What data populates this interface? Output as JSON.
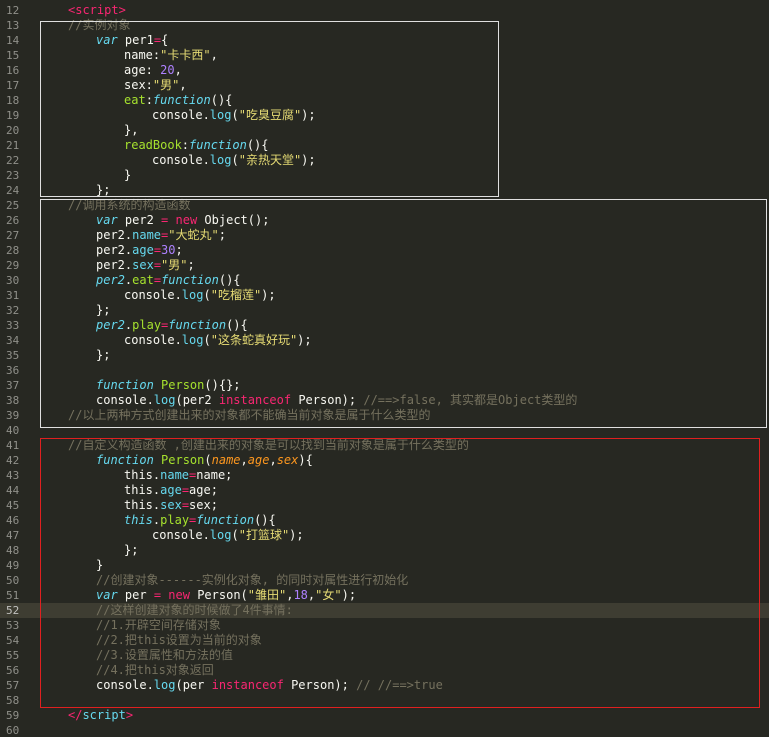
{
  "editor": {
    "theme": "monokai",
    "colors": {
      "background": "#272822",
      "highlight_box_white": "#e0e0e0",
      "highlight_box_red": "#e02020"
    },
    "current_line": 52,
    "lines": [
      {
        "n": "12",
        "indent": 4,
        "tokens": [
          [
            "tag",
            "<script>"
          ]
        ]
      },
      {
        "n": "13",
        "indent": 4,
        "tokens": [
          [
            "comment",
            "//实例对象"
          ]
        ]
      },
      {
        "n": "14",
        "indent": 8,
        "tokens": [
          [
            "kw",
            "var"
          ],
          [
            "punct",
            " per1"
          ],
          [
            "op",
            "="
          ],
          [
            "punct",
            "{"
          ]
        ]
      },
      {
        "n": "15",
        "indent": 12,
        "tokens": [
          [
            "punct",
            "name:"
          ],
          [
            "str",
            "\"卡卡西\""
          ],
          [
            "punct",
            ","
          ]
        ]
      },
      {
        "n": "16",
        "indent": 12,
        "tokens": [
          [
            "punct",
            "age: "
          ],
          [
            "num",
            "20"
          ],
          [
            "punct",
            ","
          ]
        ]
      },
      {
        "n": "17",
        "indent": 12,
        "tokens": [
          [
            "punct",
            "sex:"
          ],
          [
            "str",
            "\"男\""
          ],
          [
            "punct",
            ","
          ]
        ]
      },
      {
        "n": "18",
        "indent": 12,
        "tokens": [
          [
            "prop",
            "eat"
          ],
          [
            "punct",
            ":"
          ],
          [
            "kw",
            "function"
          ],
          [
            "punct",
            "(){"
          ]
        ]
      },
      {
        "n": "19",
        "indent": 16,
        "tokens": [
          [
            "punct",
            "console."
          ],
          [
            "sup",
            "log"
          ],
          [
            "punct",
            "("
          ],
          [
            "str",
            "\"吃臭豆腐\""
          ],
          [
            "punct",
            ");"
          ]
        ]
      },
      {
        "n": "20",
        "indent": 12,
        "tokens": [
          [
            "punct",
            "},"
          ]
        ]
      },
      {
        "n": "21",
        "indent": 12,
        "tokens": [
          [
            "prop",
            "readBook"
          ],
          [
            "punct",
            ":"
          ],
          [
            "kw",
            "function"
          ],
          [
            "punct",
            "(){"
          ]
        ]
      },
      {
        "n": "22",
        "indent": 16,
        "tokens": [
          [
            "punct",
            "console."
          ],
          [
            "sup",
            "log"
          ],
          [
            "punct",
            "("
          ],
          [
            "str",
            "\"亲热天堂\""
          ],
          [
            "punct",
            ");"
          ]
        ]
      },
      {
        "n": "23",
        "indent": 12,
        "tokens": [
          [
            "punct",
            "}"
          ]
        ]
      },
      {
        "n": "24",
        "indent": 8,
        "tokens": [
          [
            "punct",
            "};"
          ]
        ]
      },
      {
        "n": "25",
        "indent": 4,
        "tokens": [
          [
            "comment",
            "//调用系统的构造函数"
          ]
        ]
      },
      {
        "n": "26",
        "indent": 8,
        "tokens": [
          [
            "kw",
            "var"
          ],
          [
            "punct",
            " per2 "
          ],
          [
            "op",
            "="
          ],
          [
            "punct",
            " "
          ],
          [
            "op",
            "new"
          ],
          [
            "punct",
            " Object();"
          ]
        ]
      },
      {
        "n": "27",
        "indent": 8,
        "tokens": [
          [
            "punct",
            "per2."
          ],
          [
            "sup",
            "name"
          ],
          [
            "op",
            "="
          ],
          [
            "str",
            "\"大蛇丸\""
          ],
          [
            "punct",
            ";"
          ]
        ]
      },
      {
        "n": "28",
        "indent": 8,
        "tokens": [
          [
            "punct",
            "per2."
          ],
          [
            "sup",
            "age"
          ],
          [
            "op",
            "="
          ],
          [
            "num",
            "30"
          ],
          [
            "punct",
            ";"
          ]
        ]
      },
      {
        "n": "29",
        "indent": 8,
        "tokens": [
          [
            "punct",
            "per2."
          ],
          [
            "sup",
            "sex"
          ],
          [
            "op",
            "="
          ],
          [
            "str",
            "\"男\""
          ],
          [
            "punct",
            ";"
          ]
        ]
      },
      {
        "n": "30",
        "indent": 8,
        "tokens": [
          [
            "kw",
            "per2"
          ],
          [
            "punct",
            "."
          ],
          [
            "prop",
            "eat"
          ],
          [
            "op",
            "="
          ],
          [
            "kw",
            "function"
          ],
          [
            "punct",
            "(){"
          ]
        ]
      },
      {
        "n": "31",
        "indent": 12,
        "tokens": [
          [
            "punct",
            "console."
          ],
          [
            "sup",
            "log"
          ],
          [
            "punct",
            "("
          ],
          [
            "str",
            "\"吃榴莲\""
          ],
          [
            "punct",
            ");"
          ]
        ]
      },
      {
        "n": "32",
        "indent": 8,
        "tokens": [
          [
            "punct",
            "};"
          ]
        ]
      },
      {
        "n": "33",
        "indent": 8,
        "tokens": [
          [
            "kw",
            "per2"
          ],
          [
            "punct",
            "."
          ],
          [
            "prop",
            "play"
          ],
          [
            "op",
            "="
          ],
          [
            "kw",
            "function"
          ],
          [
            "punct",
            "(){"
          ]
        ]
      },
      {
        "n": "34",
        "indent": 12,
        "tokens": [
          [
            "punct",
            "console."
          ],
          [
            "sup",
            "log"
          ],
          [
            "punct",
            "("
          ],
          [
            "str",
            "\"这条蛇真好玩\""
          ],
          [
            "punct",
            ");"
          ]
        ]
      },
      {
        "n": "35",
        "indent": 8,
        "tokens": [
          [
            "punct",
            "};"
          ]
        ]
      },
      {
        "n": "36",
        "indent": 0,
        "tokens": []
      },
      {
        "n": "37",
        "indent": 8,
        "tokens": [
          [
            "kw",
            "function"
          ],
          [
            "punct",
            " "
          ],
          [
            "fn",
            "Person"
          ],
          [
            "punct",
            "(){};"
          ]
        ]
      },
      {
        "n": "38",
        "indent": 8,
        "tokens": [
          [
            "punct",
            "console."
          ],
          [
            "sup",
            "log"
          ],
          [
            "punct",
            "(per2 "
          ],
          [
            "op",
            "instanceof"
          ],
          [
            "punct",
            " Person); "
          ],
          [
            "comment",
            "//==>false, 其实都是Object类型的"
          ]
        ]
      },
      {
        "n": "39",
        "indent": 4,
        "tokens": [
          [
            "comment",
            "//以上两种方式创建出来的对象都不能确当前对象是属于什么类型的"
          ]
        ]
      },
      {
        "n": "40",
        "indent": 0,
        "tokens": []
      },
      {
        "n": "41",
        "indent": 4,
        "tokens": [
          [
            "comment",
            "//自定义构造函数 ,创建出来的对象是可以找到当前对象是属于什么类型的"
          ]
        ]
      },
      {
        "n": "42",
        "indent": 8,
        "tokens": [
          [
            "kw",
            "function"
          ],
          [
            "punct",
            " "
          ],
          [
            "fn",
            "Person"
          ],
          [
            "punct",
            "("
          ],
          [
            "param",
            "name"
          ],
          [
            "punct",
            ","
          ],
          [
            "param",
            "age"
          ],
          [
            "punct",
            ","
          ],
          [
            "param",
            "sex"
          ],
          [
            "punct",
            "){"
          ]
        ]
      },
      {
        "n": "43",
        "indent": 12,
        "tokens": [
          [
            "punct",
            "this."
          ],
          [
            "sup",
            "name"
          ],
          [
            "op",
            "="
          ],
          [
            "punct",
            "name;"
          ]
        ]
      },
      {
        "n": "44",
        "indent": 12,
        "tokens": [
          [
            "punct",
            "this."
          ],
          [
            "sup",
            "age"
          ],
          [
            "op",
            "="
          ],
          [
            "punct",
            "age;"
          ]
        ]
      },
      {
        "n": "45",
        "indent": 12,
        "tokens": [
          [
            "punct",
            "this."
          ],
          [
            "sup",
            "sex"
          ],
          [
            "op",
            "="
          ],
          [
            "punct",
            "sex;"
          ]
        ]
      },
      {
        "n": "46",
        "indent": 12,
        "tokens": [
          [
            "kw",
            "this"
          ],
          [
            "punct",
            "."
          ],
          [
            "prop",
            "play"
          ],
          [
            "op",
            "="
          ],
          [
            "kw",
            "function"
          ],
          [
            "punct",
            "(){"
          ]
        ]
      },
      {
        "n": "47",
        "indent": 16,
        "tokens": [
          [
            "punct",
            "console."
          ],
          [
            "sup",
            "log"
          ],
          [
            "punct",
            "("
          ],
          [
            "str",
            "\"打篮球\""
          ],
          [
            "punct",
            ");"
          ]
        ]
      },
      {
        "n": "48",
        "indent": 12,
        "tokens": [
          [
            "punct",
            "};"
          ]
        ]
      },
      {
        "n": "49",
        "indent": 8,
        "tokens": [
          [
            "punct",
            "}"
          ]
        ]
      },
      {
        "n": "50",
        "indent": 8,
        "tokens": [
          [
            "comment",
            "//创建对象------实例化对象, 的同时对属性进行初始化"
          ]
        ]
      },
      {
        "n": "51",
        "indent": 8,
        "tokens": [
          [
            "kw",
            "var"
          ],
          [
            "punct",
            " per "
          ],
          [
            "op",
            "="
          ],
          [
            "punct",
            " "
          ],
          [
            "op",
            "new"
          ],
          [
            "punct",
            " Person("
          ],
          [
            "str",
            "\"雏田\""
          ],
          [
            "punct",
            ","
          ],
          [
            "num",
            "18"
          ],
          [
            "punct",
            ","
          ],
          [
            "str",
            "\"女\""
          ],
          [
            "punct",
            ");"
          ]
        ]
      },
      {
        "n": "52",
        "indent": 8,
        "tokens": [
          [
            "comment",
            "//这样创建对象的时候做了4件事情:"
          ]
        ]
      },
      {
        "n": "53",
        "indent": 8,
        "tokens": [
          [
            "comment",
            "//1.开辟空间存储对象"
          ]
        ]
      },
      {
        "n": "54",
        "indent": 8,
        "tokens": [
          [
            "comment",
            "//2.把this设置为当前的对象"
          ]
        ]
      },
      {
        "n": "55",
        "indent": 8,
        "tokens": [
          [
            "comment",
            "//3.设置属性和方法的值"
          ]
        ]
      },
      {
        "n": "56",
        "indent": 8,
        "tokens": [
          [
            "comment",
            "//4.把this对象返回"
          ]
        ]
      },
      {
        "n": "57",
        "indent": 8,
        "tokens": [
          [
            "punct",
            "console."
          ],
          [
            "sup",
            "log"
          ],
          [
            "punct",
            "(per "
          ],
          [
            "op",
            "instanceof"
          ],
          [
            "punct",
            " Person); "
          ],
          [
            "comment",
            "// //==>true"
          ]
        ]
      },
      {
        "n": "58",
        "indent": 0,
        "tokens": []
      },
      {
        "n": "59",
        "indent": 4,
        "tokens": [
          [
            "tag",
            "</"
          ],
          [
            "sup",
            "script"
          ],
          [
            "tag",
            ">"
          ]
        ]
      },
      {
        "n": "60",
        "indent": 0,
        "tokens": []
      }
    ]
  }
}
